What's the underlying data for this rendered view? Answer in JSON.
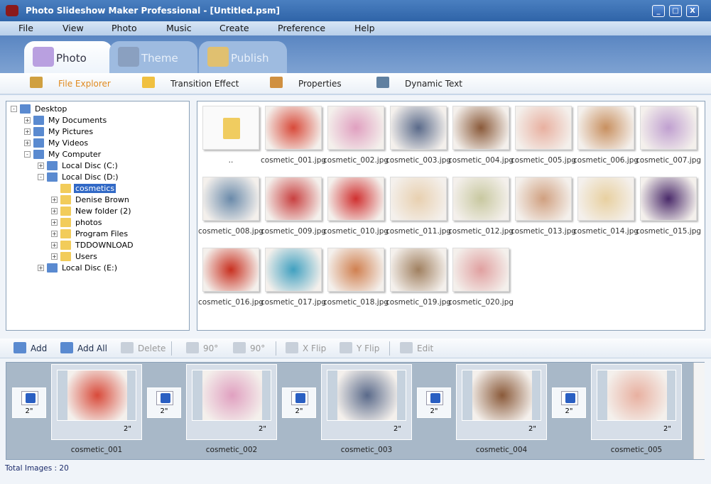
{
  "window": {
    "title": "Photo Slideshow Maker Professional - [Untitled.psm]",
    "buttons": [
      "_",
      "□",
      "X"
    ]
  },
  "menu": [
    "File",
    "View",
    "Photo",
    "Music",
    "Create",
    "Preference",
    "Help"
  ],
  "tabs": [
    {
      "label": "Photo",
      "active": true,
      "icon": "photo-icon"
    },
    {
      "label": "Theme",
      "icon": "theme-icon"
    },
    {
      "label": "Publish",
      "icon": "publish-icon"
    }
  ],
  "subtabs": [
    {
      "label": "File Explorer",
      "active": true,
      "icon": "magnifier-icon"
    },
    {
      "label": "Transition Effect",
      "icon": "star-icon"
    },
    {
      "label": "Properties",
      "icon": "properties-icon"
    },
    {
      "label": "Dynamic Text",
      "icon": "text-icon"
    }
  ],
  "tree": [
    {
      "label": "Desktop",
      "level": 0,
      "exp": "-"
    },
    {
      "label": "My Documents",
      "level": 1,
      "exp": "+"
    },
    {
      "label": "My Pictures",
      "level": 1,
      "exp": "+"
    },
    {
      "label": "My Videos",
      "level": 1,
      "exp": "+"
    },
    {
      "label": "My Computer",
      "level": 1,
      "exp": "-"
    },
    {
      "label": "Local Disc  (C:)",
      "level": 2,
      "exp": "+"
    },
    {
      "label": "Local Disc (D:)",
      "level": 2,
      "exp": "-"
    },
    {
      "label": "cosmetics",
      "level": 3,
      "exp": "",
      "selected": true
    },
    {
      "label": "Denise Brown",
      "level": 3,
      "exp": "+"
    },
    {
      "label": "New folder (2)",
      "level": 3,
      "exp": "+"
    },
    {
      "label": "photos",
      "level": 3,
      "exp": "+"
    },
    {
      "label": "Program Files",
      "level": 3,
      "exp": "+"
    },
    {
      "label": "TDDOWNLOAD",
      "level": 3,
      "exp": "+"
    },
    {
      "label": "Users",
      "level": 3,
      "exp": "+"
    },
    {
      "label": "Local Disc (E:)",
      "level": 2,
      "exp": "+"
    }
  ],
  "files": [
    "..",
    "cosmetic_001.jpg",
    "cosmetic_002.jpg",
    "cosmetic_003.jpg",
    "cosmetic_004.jpg",
    "cosmetic_005.jpg",
    "cosmetic_006.jpg",
    "cosmetic_007.jpg",
    "cosmetic_008.jpg",
    "cosmetic_009.jpg",
    "cosmetic_010.jpg",
    "cosmetic_011.jpg",
    "cosmetic_012.jpg",
    "cosmetic_013.jpg",
    "cosmetic_014.jpg",
    "cosmetic_015.jpg",
    "cosmetic_016.jpg",
    "cosmetic_017.jpg",
    "cosmetic_018.jpg",
    "cosmetic_019.jpg",
    "cosmetic_020.jpg"
  ],
  "thumb_colors": [
    "#e8c860",
    "#d84a3a",
    "#e0a0c0",
    "#5a6a8a",
    "#8a5a3a",
    "#e8b0a0",
    "#c89060",
    "#c0a0d0",
    "#6a8aaa",
    "#c84040",
    "#d03030",
    "#e8d0b0",
    "#c8c8a0",
    "#d0a080",
    "#e8d0a0",
    "#4a2a6a",
    "#c83020",
    "#40a0c0",
    "#d08050",
    "#a08060",
    "#e0a0a0"
  ],
  "toolbar": [
    {
      "label": "Add",
      "enabled": true,
      "icon": "add-icon"
    },
    {
      "label": "Add All",
      "enabled": true,
      "icon": "add-all-icon"
    },
    {
      "label": "Delete",
      "enabled": false,
      "icon": "delete-icon"
    },
    {
      "label": "90°",
      "enabled": false,
      "icon": "rotate-left-icon"
    },
    {
      "label": "90°",
      "enabled": false,
      "icon": "rotate-right-icon"
    },
    {
      "label": "X Flip",
      "enabled": false,
      "icon": "x-flip-icon"
    },
    {
      "label": "Y Flip",
      "enabled": false,
      "icon": "y-flip-icon"
    },
    {
      "label": "Edit",
      "enabled": false,
      "icon": "edit-icon"
    }
  ],
  "storyboard": [
    {
      "name": "cosmetic_001",
      "duration": "2\"",
      "transition": "2\""
    },
    {
      "name": "cosmetic_002",
      "duration": "2\"",
      "transition": "2\""
    },
    {
      "name": "cosmetic_003",
      "duration": "2\"",
      "transition": "2\""
    },
    {
      "name": "cosmetic_004",
      "duration": "2\"",
      "transition": "2\""
    },
    {
      "name": "cosmetic_005",
      "duration": "2\"",
      "transition": "2\""
    }
  ],
  "status": "Total Images : 20"
}
